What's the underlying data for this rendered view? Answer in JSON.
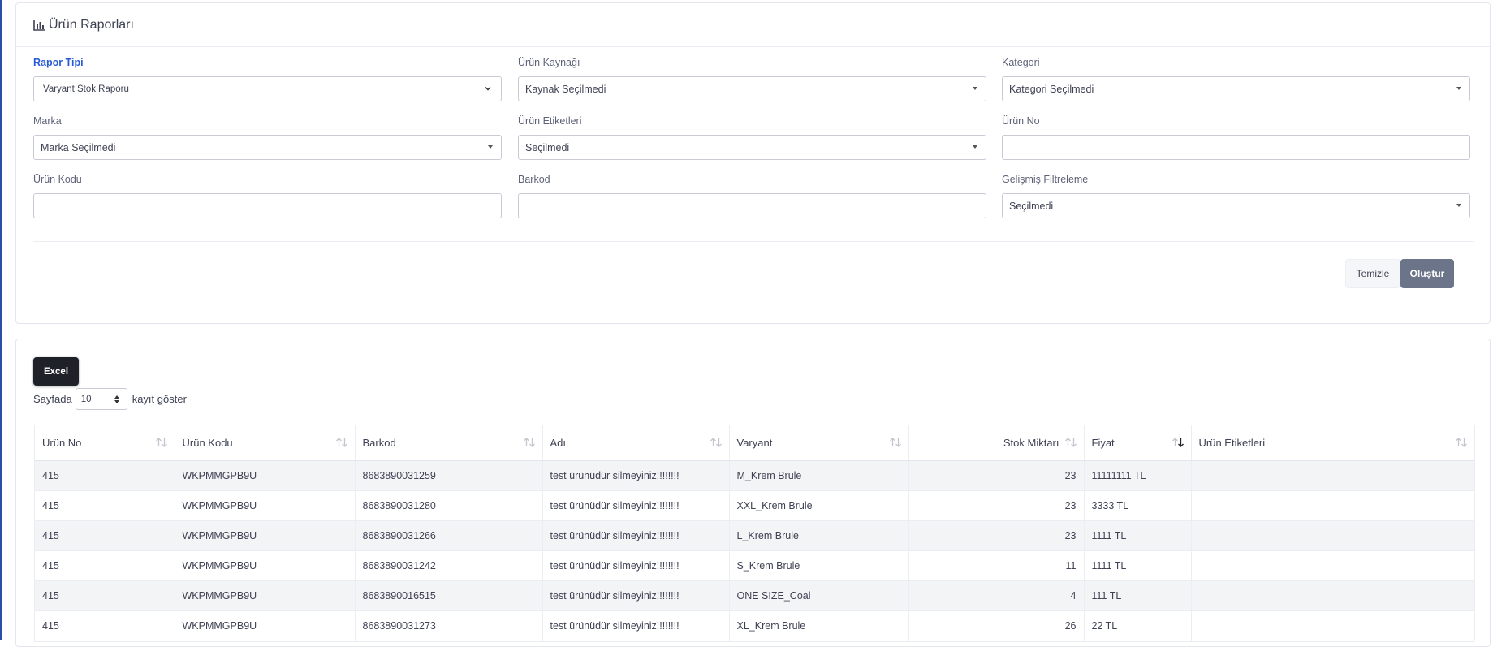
{
  "header": {
    "title": "Ürün Raporları",
    "icon": "bar-chart-icon"
  },
  "filters": {
    "report_type": {
      "label": "Rapor Tipi",
      "value": "Varyant Stok Raporu"
    },
    "product_source": {
      "label": "Ürün Kaynağı",
      "value": "Kaynak Seçilmedi"
    },
    "category": {
      "label": "Kategori",
      "value": "Kategori Seçilmedi"
    },
    "brand": {
      "label": "Marka",
      "value": "Marka Seçilmedi"
    },
    "product_tags": {
      "label": "Ürün Etiketleri",
      "value": "Seçilmedi"
    },
    "product_no": {
      "label": "Ürün No",
      "value": ""
    },
    "product_code": {
      "label": "Ürün Kodu",
      "value": ""
    },
    "barcode": {
      "label": "Barkod",
      "value": ""
    },
    "advanced_filter": {
      "label": "Gelişmiş Filtreleme",
      "value": "Seçilmedi"
    }
  },
  "actions": {
    "clear_label": "Temizle",
    "create_label": "Oluştur"
  },
  "table_controls": {
    "excel_label": "Excel",
    "page_len_prefix": "Sayfada",
    "page_len_value": "10",
    "page_len_suffix": "kayıt göster"
  },
  "table": {
    "columns": [
      "Ürün No",
      "Ürün Kodu",
      "Barkod",
      "Adı",
      "Varyant",
      "Stok Miktarı",
      "Fiyat",
      "Ürün Etiketleri"
    ],
    "rows": [
      [
        "415",
        "WKPMMGPB9U",
        "8683890031259",
        "test ürünüdür silmeyiniz!!!!!!!!",
        "M_Krem Brule",
        "23",
        "11111111 TL",
        ""
      ],
      [
        "415",
        "WKPMMGPB9U",
        "8683890031280",
        "test ürünüdür silmeyiniz!!!!!!!!",
        "XXL_Krem Brule",
        "23",
        "3333 TL",
        ""
      ],
      [
        "415",
        "WKPMMGPB9U",
        "8683890031266",
        "test ürünüdür silmeyiniz!!!!!!!!",
        "L_Krem Brule",
        "23",
        "1111 TL",
        ""
      ],
      [
        "415",
        "WKPMMGPB9U",
        "8683890031242",
        "test ürünüdür silmeyiniz!!!!!!!!",
        "S_Krem Brule",
        "11",
        "1111 TL",
        ""
      ],
      [
        "415",
        "WKPMMGPB9U",
        "8683890016515",
        "test ürünüdür silmeyiniz!!!!!!!!",
        "ONE SIZE_Coal",
        "4",
        "111 TL",
        ""
      ],
      [
        "415",
        "WKPMMGPB9U",
        "8683890031273",
        "test ürünüdür silmeyiniz!!!!!!!!",
        "XL_Krem Brule",
        "26",
        "22 TL",
        ""
      ]
    ]
  },
  "colors": {
    "accent": "#2a5bd7",
    "primary_button": "#6b7488",
    "excel_button": "#1e2128"
  }
}
